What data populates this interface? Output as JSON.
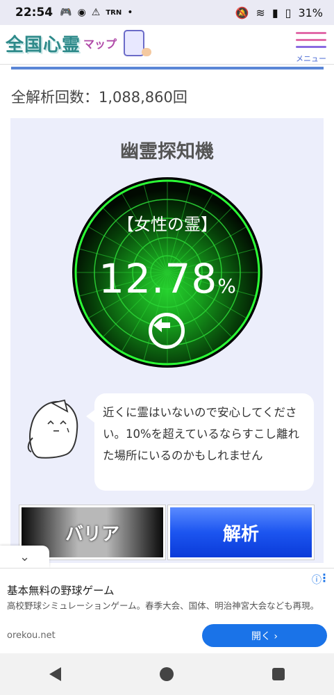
{
  "status_bar": {
    "time": "22:54",
    "icons": [
      "game-controller-icon",
      "discord-icon",
      "warning-icon",
      "TRN",
      "•"
    ],
    "battery": "31%"
  },
  "header": {
    "logo_text": "全国心霊",
    "logo_sub": "マップ",
    "menu_label": "メニュー"
  },
  "stats": {
    "total_label": "全解析回数：1,088,860回"
  },
  "detector": {
    "title": "幽霊探知機",
    "spirit_type": "【女性の霊】",
    "value": "12.78",
    "unit": "%"
  },
  "message": "近くに霊はいないので安心してください。10%を超えているならすこし離れた場所にいるのかもしれません",
  "buttons": {
    "barrier": "バリア",
    "analyze": "解析"
  },
  "ad": {
    "title": "基本無料の野球ゲーム",
    "description": "高校野球シミュレーションゲーム。春季大会、国体、明治神宮大会なども再現。",
    "domain": "orekou.net",
    "open_label": "開く ›"
  },
  "colors": {
    "accent": "#5a86d6",
    "radar_green": "#1ecf28",
    "analyze_blue": "#1c55f0"
  }
}
